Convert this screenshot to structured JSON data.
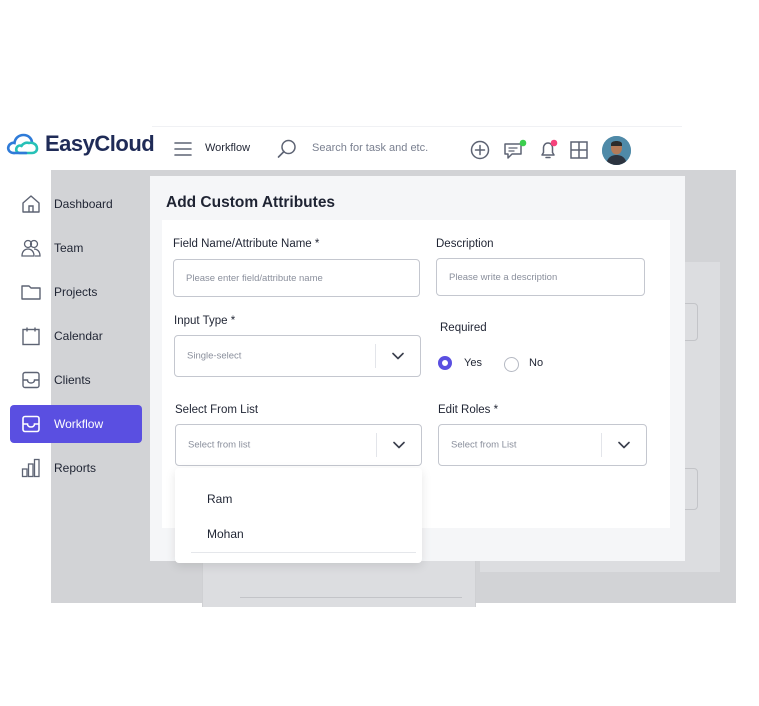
{
  "app": {
    "name": "EasyCloud"
  },
  "topbar": {
    "breadcrumb": "Workflow",
    "search_placeholder": "Search for task and etc."
  },
  "sidebar": {
    "items": [
      {
        "label": "Dashboard",
        "icon": "home-icon",
        "active": false
      },
      {
        "label": "Team",
        "icon": "team-icon",
        "active": false
      },
      {
        "label": "Projects",
        "icon": "folder-icon",
        "active": false
      },
      {
        "label": "Calendar",
        "icon": "calendar-icon",
        "active": false
      },
      {
        "label": "Clients",
        "icon": "inbox-icon",
        "active": false
      },
      {
        "label": "Workflow",
        "icon": "workflow-icon",
        "active": true
      },
      {
        "label": "Reports",
        "icon": "bar-chart-icon",
        "active": false
      }
    ]
  },
  "form": {
    "title": "Add Custom Attributes",
    "field_name": {
      "label": "Field Name/Attribute Name *",
      "placeholder": "Please enter field/attribute name"
    },
    "description": {
      "label": "Description",
      "placeholder": "Please write a description"
    },
    "input_type": {
      "label": "Input Type *",
      "value": "Single-select"
    },
    "required": {
      "label": "Required",
      "options": [
        "Yes",
        "No"
      ],
      "selected": "Yes"
    },
    "select_from_list": {
      "label": "Select From List",
      "placeholder": "Select from list",
      "options": [
        "Ram",
        "Mohan"
      ]
    },
    "edit_roles": {
      "label": "Edit Roles *",
      "placeholder": "Select from List"
    }
  },
  "colors": {
    "accent": "#5a4fe1",
    "notification_green": "#3ccf4e",
    "notification_pink": "#f5427b",
    "logo_blue": "#2f7bd8",
    "logo_teal": "#27c1b7"
  }
}
